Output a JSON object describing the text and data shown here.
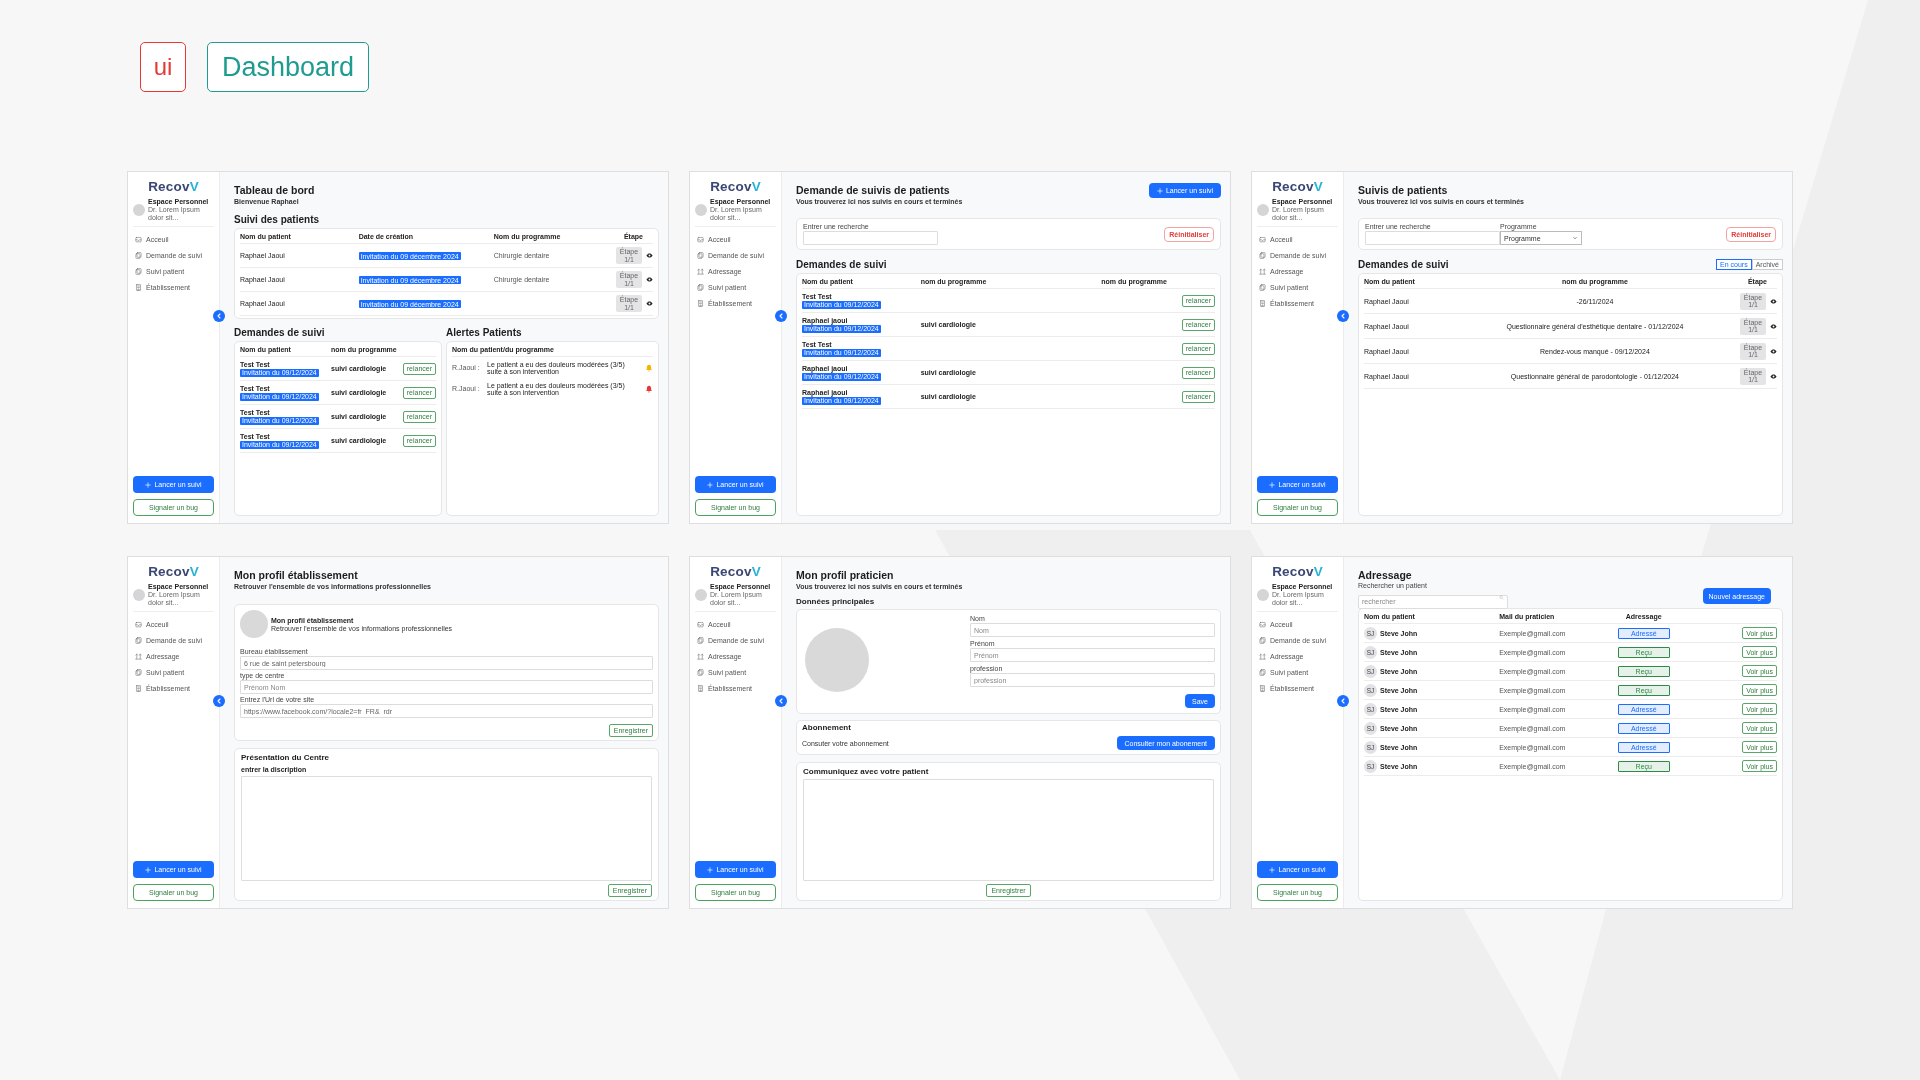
{
  "header": {
    "badge": "ui",
    "title": "Dashboard"
  },
  "screens": [
    {
      "sidebar": {
        "logo": "Recov",
        "logo_accent": "V",
        "profile_name": "Espace Personnel",
        "profile_detail": "Dr. Lorem Ipsum dolor sit...",
        "nav": [
          {
            "label": "Acceuil",
            "kind": "inbox"
          },
          {
            "label": "Demande de suivi",
            "kind": "documents"
          },
          {
            "label": "Suivi patient",
            "kind": "documents"
          },
          {
            "label": "Établissement",
            "kind": "building"
          }
        ],
        "primary_button": "Lancer un suivi",
        "secondary_button": "Signaler un bug"
      },
      "title": "Tableau de bord",
      "subtitle": "Bienvenue Raphael",
      "blocks": [
        {
          "kind": "section",
          "text": "Suivi des patients"
        },
        {
          "kind": "patients",
          "columns": [
            "Nom du patient",
            "Date de création",
            "Nom du programme",
            "Étape"
          ],
          "rows": [
            {
              "patient": "Raphael Jaoui",
              "date": "Invitation du 09 décembre 2024",
              "program": "Chirurgie dentaire",
              "step": "Étape 1/1"
            },
            {
              "patient": "Raphael Jaoui",
              "date": "Invitation du 09 décembre 2024",
              "program": "Chirurgie dentaire",
              "step": "Étape 1/1"
            },
            {
              "patient": "Raphael Jaoui",
              "date": "Invitation du 09 décembre 2024",
              "step": "Étape 1/1"
            }
          ]
        },
        {
          "kind": "split",
          "items": [
            {
              "title": "Demandes de suivi",
              "table": {
                "kind": "requests",
                "columns": [
                  "Nom du patient",
                  "nom du programme"
                ],
                "rows": [
                  {
                    "patient": "Test Test",
                    "invitation": "Invitation du 09/12/2024",
                    "program": "suivi cardiologie",
                    "action": "relancer"
                  },
                  {
                    "patient": "Test Test",
                    "invitation": "Invitation du 09/12/2024",
                    "program": "suivi cardiologie",
                    "action": "relancer"
                  },
                  {
                    "patient": "Test Test",
                    "invitation": "Invitation du 09/12/2024",
                    "program": "suivi cardiologie",
                    "action": "relancer"
                  },
                  {
                    "patient": "Test Test",
                    "invitation": "Invitation du 09/12/2024",
                    "program": "suivi cardiologie",
                    "action": "relancer"
                  }
                ]
              }
            },
            {
              "title": "Alertes Patients",
              "table": {
                "kind": "alerts",
                "columns": [
                  "Nom du patient/du programme"
                ],
                "rows": [
                  {
                    "patient": "R.Jaoui :",
                    "message": "Le patient a eu des douleurs modérées (3/5) suite à son intervention",
                    "color": "#f5b400"
                  },
                  {
                    "patient": "R.Jaoui :",
                    "message": "Le patient a eu des douleurs modérées (3/5) suite à son intervention",
                    "color": "#e53935"
                  }
                ]
              }
            }
          ]
        }
      ]
    },
    {
      "sidebar": {
        "logo": "Recov",
        "logo_accent": "V",
        "profile_name": "Espace Personnel",
        "profile_detail": "Dr. Lorem Ipsum dolor sit...",
        "nav": [
          {
            "label": "Acceuil",
            "kind": "inbox"
          },
          {
            "label": "Demande de suivi",
            "kind": "documents"
          },
          {
            "label": "Adressage",
            "kind": "arrows"
          },
          {
            "label": "Suivi patient",
            "kind": "documents"
          },
          {
            "label": "Établissement",
            "kind": "building"
          }
        ],
        "primary_button": "Lancer un suivi",
        "secondary_button": "Signaler un bug"
      },
      "title": "Demande de suivis de patients",
      "subtitle": "Vous trouverez ici nos suivis en cours et terminés",
      "header_button": "Lancer un suivi",
      "blocks": [
        {
          "kind": "filters",
          "fields": [
            {
              "label": "Entrer une recherche",
              "kind": "text"
            }
          ],
          "button": "Réinitialiser"
        },
        {
          "kind": "section",
          "text": "Demandes de suivi"
        },
        {
          "kind": "requests",
          "columns": [
            "Nom du patient",
            "nom du programme",
            "nom du programme"
          ],
          "rows": [
            {
              "patient": "Test Test",
              "invitation": "Invitation du 09/12/2024",
              "action": "relancer"
            },
            {
              "patient": "Raphael jaoui",
              "invitation": "Invitation du 09/12/2024",
              "program": "suivi cardiologie",
              "action": "relancer"
            },
            {
              "patient": "Test Test",
              "invitation": "Invitation du 09/12/2024",
              "action": "relancer"
            },
            {
              "patient": "Raphael jaoui",
              "invitation": "Invitation du 09/12/2024",
              "program": "suivi cardiologie",
              "action": "relancer"
            },
            {
              "patient": "Raphael jaoui",
              "invitation": "Invitation du 09/12/2024",
              "program": "suivi cardiologie",
              "action": "relancer"
            }
          ]
        }
      ]
    },
    {
      "sidebar": {
        "logo": "Recov",
        "logo_accent": "V",
        "profile_name": "Espace Personnel",
        "profile_detail": "Dr. Lorem Ipsum dolor sit...",
        "nav": [
          {
            "label": "Acceuil",
            "kind": "inbox"
          },
          {
            "label": "Demande de suivi",
            "kind": "documents"
          },
          {
            "label": "Adressage",
            "kind": "arrows"
          },
          {
            "label": "Suivi patient",
            "kind": "documents"
          },
          {
            "label": "Établissement",
            "kind": "building"
          }
        ],
        "primary_button": "Lancer un suivi",
        "secondary_button": "Signaler un bug"
      },
      "title": "Suivis de patients",
      "subtitle": "Vous trouverez ici vos suivis en cours et terminés",
      "blocks": [
        {
          "kind": "filters",
          "fields": [
            {
              "label": "Entrer une recherche",
              "kind": "text"
            },
            {
              "label": "Programme",
              "kind": "select",
              "value": "Programme"
            }
          ],
          "button": "Réinitialiser"
        },
        {
          "kind": "section",
          "text": "Demandes de suivi",
          "toggle": [
            {
              "label": "En cours",
              "selected": true
            },
            {
              "label": "Archivé",
              "selected": false
            }
          ]
        },
        {
          "kind": "followups",
          "columns": [
            "Nom du patient",
            "nom du programme",
            "Étape"
          ],
          "rows": [
            {
              "patient": "Raphael Jaoui",
              "program": "-26/11/2024",
              "step": "Étape 1/1"
            },
            {
              "patient": "Raphael Jaoui",
              "program": "Questionnaire général d'esthétique dentaire - 01/12/2024",
              "step": "Étape 1/1"
            },
            {
              "patient": "Raphael Jaoui",
              "program": "Rendez-vous manqué - 09/12/2024",
              "step": "Étape 1/1"
            },
            {
              "patient": "Raphael Jaoui",
              "program": "Questionnaire général de parodontologie - 01/12/2024",
              "step": "Étape 1/1"
            }
          ]
        }
      ]
    },
    {
      "sidebar": {
        "logo": "Recov",
        "logo_accent": "V",
        "profile_name": "Espace Personnel",
        "profile_detail": "Dr. Lorem Ipsum dolor sit...",
        "nav": [
          {
            "label": "Acceuil",
            "kind": "inbox"
          },
          {
            "label": "Demande de suivi",
            "kind": "documents"
          },
          {
            "label": "Adressage",
            "kind": "arrows"
          },
          {
            "label": "Suivi patient",
            "kind": "documents"
          },
          {
            "label": "Établissement",
            "kind": "building"
          }
        ],
        "primary_button": "Lancer un suivi",
        "secondary_button": "Signaler un bug"
      },
      "title": "Mon profil établissement",
      "subtitle": "Retrouver l'ensemble de vos informations professionnelles",
      "blocks": [
        {
          "kind": "profile_form",
          "avatar_title": "Mon profil établissement",
          "avatar_subtitle": "Retrouver l'ensemble de vos informations professionnelles",
          "fields": [
            {
              "label": "Bureau établissement",
              "value": "6 rue de saint petersbourg"
            },
            {
              "label": "type de centre",
              "placeholder": "Prénom Nom"
            },
            {
              "label": "Entrez l'Url de votre site",
              "value": "https://www.facebook.com/?locale2=fr_FR&_rdr"
            }
          ],
          "button": "Enregistrer"
        },
        {
          "kind": "description",
          "title": "Présentation du Centre",
          "label": "entrer la discription",
          "button": "Enregistrer"
        }
      ]
    },
    {
      "sidebar": {
        "logo": "Recov",
        "logo_accent": "V",
        "profile_name": "Espace Personnel",
        "profile_detail": "Dr. Lorem Ipsum dolor sit...",
        "nav": [
          {
            "label": "Acceuil",
            "kind": "inbox"
          },
          {
            "label": "Demande de suivi",
            "kind": "documents"
          },
          {
            "label": "Adressage",
            "kind": "arrows"
          },
          {
            "label": "Suivi patient",
            "kind": "documents"
          },
          {
            "label": "Établissement",
            "kind": "building"
          }
        ],
        "primary_button": "Lancer un suivi",
        "secondary_button": "Signaler un bug"
      },
      "title": "Mon profil praticien",
      "subtitle": "Vous trouverez ici nos suivis en cours et terminés",
      "blocks": [
        {
          "kind": "subsection",
          "text": "Données principales"
        },
        {
          "kind": "identity",
          "fields": [
            {
              "label": "Nom",
              "placeholder": "Nom"
            },
            {
              "label": "Prénom",
              "placeholder": "Prénom"
            },
            {
              "label": "profession",
              "placeholder": "profession"
            }
          ],
          "button": "Save"
        },
        {
          "kind": "row_panel",
          "title": "Abonnement",
          "text": "Consuter votre abonnement",
          "button": "Consulter mon abonement"
        },
        {
          "kind": "message",
          "title": "Communiquez avec votre patient",
          "button": "Enregistrer"
        }
      ]
    },
    {
      "sidebar": {
        "logo": "Recov",
        "logo_accent": "V",
        "profile_name": "Espace Personnel",
        "profile_detail": "Dr. Lorem Ipsum dolor sit...",
        "nav": [
          {
            "label": "Acceuil",
            "kind": "inbox"
          },
          {
            "label": "Demande de suivi",
            "kind": "documents"
          },
          {
            "label": "Adressage",
            "kind": "arrows"
          },
          {
            "label": "Suivi patient",
            "kind": "documents"
          },
          {
            "label": "Établissement",
            "kind": "building"
          }
        ],
        "primary_button": "Lancer un suivi",
        "secondary_button": "Signaler un bug"
      },
      "title": "Adressage",
      "blocks": [
        {
          "kind": "search",
          "label": "Rechercher un patient",
          "placeholder": "rechercher",
          "button": "Nouvel adressage"
        },
        {
          "kind": "referrals",
          "columns": [
            "Nom du patient",
            "Mail du praticien",
            "Adressage"
          ],
          "rows": [
            {
              "initials": "SJ",
              "patient": "Steve John",
              "email": "Exemple@gmail.com",
              "status": "Adressé",
              "color": "#1a6dff",
              "action": "Voir plus"
            },
            {
              "initials": "SJ",
              "patient": "Steve John",
              "email": "Exemple@gmail.com",
              "status": "Reçu",
              "color": "#2e8b47",
              "action": "Voir plus"
            },
            {
              "initials": "SJ",
              "patient": "Steve John",
              "email": "Exemple@gmail.com",
              "status": "Reçu",
              "color": "#2e8b47",
              "action": "Voir plus"
            },
            {
              "initials": "SJ",
              "patient": "Steve John",
              "email": "Exemple@gmail.com",
              "status": "Reçu",
              "color": "#2e8b47",
              "action": "Voir plus"
            },
            {
              "initials": "SJ",
              "patient": "Steve John",
              "email": "Exemple@gmail.com",
              "status": "Adressé",
              "color": "#1a6dff",
              "action": "Voir plus"
            },
            {
              "initials": "SJ",
              "patient": "Steve John",
              "email": "Exemple@gmail.com",
              "status": "Adressé",
              "color": "#1a6dff",
              "action": "Voir plus"
            },
            {
              "initials": "SJ",
              "patient": "Steve John",
              "email": "Exemple@gmail.com",
              "status": "Adressé",
              "color": "#1a6dff",
              "action": "Voir plus"
            },
            {
              "initials": "SJ",
              "patient": "Steve John",
              "email": "Exemple@gmail.com",
              "status": "Reçu",
              "color": "#2e8b47",
              "action": "Voir plus"
            }
          ]
        }
      ]
    }
  ]
}
